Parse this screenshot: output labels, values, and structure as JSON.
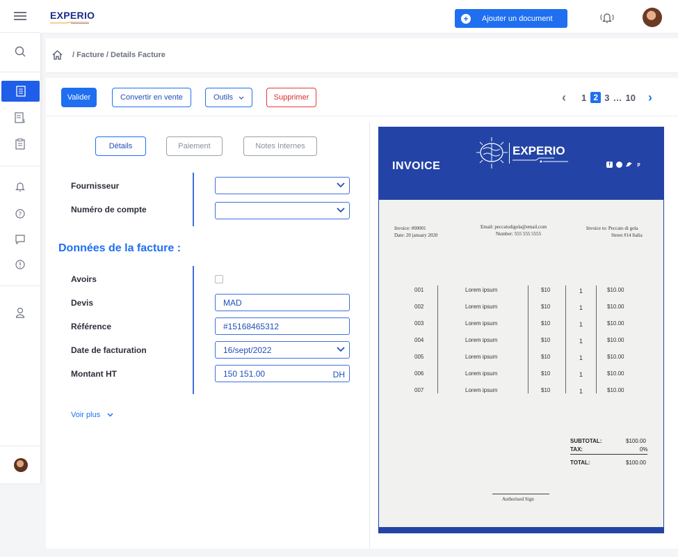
{
  "app": {
    "logo": "EXPERIO"
  },
  "topbar": {
    "add_document": "Ajouter un document"
  },
  "breadcrumb": {
    "path": "/  Facture / Details Facture"
  },
  "toolbar": {
    "valider": "Valider",
    "convertir": "Convertir en vente",
    "outils": "Outils",
    "supprimer": "Supprimer"
  },
  "pager": {
    "prev": "‹",
    "p1": "1",
    "p2": "2",
    "p3": "3",
    "ellipsis": "…",
    "p10": "10",
    "next": "›"
  },
  "tabs": {
    "details": "Détails",
    "paiement": "Paiement",
    "notes": "Notes Internes"
  },
  "form": {
    "fournisseur": "Fournisseur",
    "numero_compte": "Numéro de compte",
    "section_title": "Données de la facture :",
    "avoirs": "Avoirs",
    "devis": "Devis",
    "devis_value": "MAD",
    "reference": "Référence",
    "reference_value": "#15168465312",
    "date_facturation": "Date de facturation",
    "date_value": "16/sept/2022",
    "montant_ht": "Montant HT",
    "montant_value": "150 151.00",
    "montant_suffix": "DH",
    "voir_plus": "Voir plus"
  },
  "invoice": {
    "title": "INVOICE",
    "brand": "EXPERIO",
    "invoice_no": "Invoice: #00001",
    "date": "Date: 20 january 2020",
    "email": "Email: peccatodigola@email.com",
    "number": "Number: 555 555 5555",
    "invoice_to": "Invoice to: Peccato di gola",
    "street": "Street #14 Italia",
    "rows": [
      {
        "id": "001",
        "desc": "Lorem ipsum",
        "price": "$10",
        "qty": "1",
        "total": "$10.00"
      },
      {
        "id": "002",
        "desc": "Lorem ipsum",
        "price": "$10",
        "qty": "1",
        "total": "$10.00"
      },
      {
        "id": "003",
        "desc": "Lorem ipsum",
        "price": "$10",
        "qty": "1",
        "total": "$10.00"
      },
      {
        "id": "004",
        "desc": "Lorem ipsum",
        "price": "$10",
        "qty": "1",
        "total": "$10.00"
      },
      {
        "id": "005",
        "desc": "Lorem ipsum",
        "price": "$10",
        "qty": "1",
        "total": "$10.00"
      },
      {
        "id": "006",
        "desc": "Lorem ipsum",
        "price": "$10",
        "qty": "1",
        "total": "$10.00"
      },
      {
        "id": "007",
        "desc": "Lorem ipsum",
        "price": "$10",
        "qty": "1",
        "total": "$10.00"
      }
    ],
    "subtotal_label": "SUBTOTAL:",
    "subtotal": "$100.00",
    "tax_label": "TAX:",
    "tax": "0%",
    "total_label": "TOTAL:",
    "total": "$100.00",
    "signature": "Authorised Sign"
  },
  "colors": {
    "primary": "#1f6ff0",
    "invoice_blue": "#2344a6",
    "danger": "#e53935"
  },
  "icons": [
    "menu-icon",
    "search-icon",
    "invoice-icon",
    "receipt-icon",
    "clipboard-icon",
    "bell-icon",
    "help-icon",
    "chat-icon",
    "alert-icon",
    "user-icon",
    "home-icon",
    "chevron-down-icon",
    "plus-icon"
  ]
}
